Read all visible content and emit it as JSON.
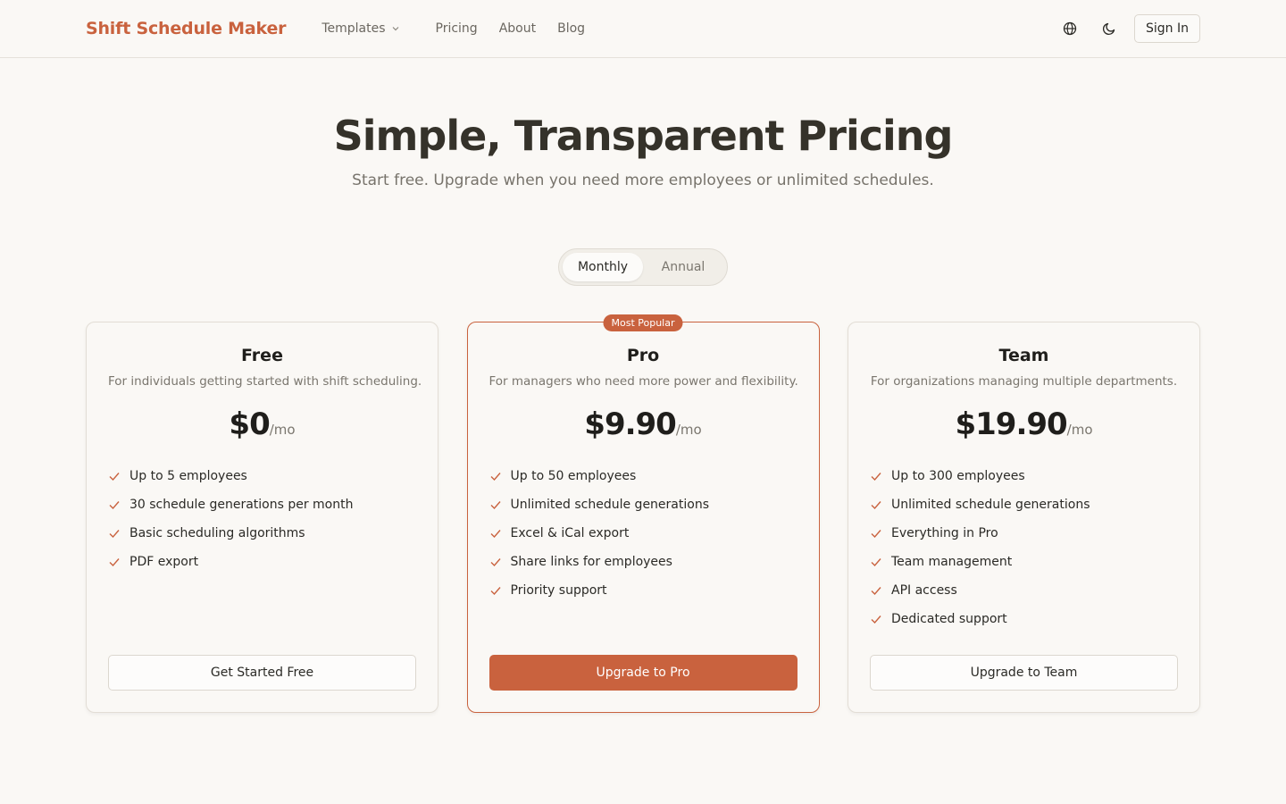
{
  "brand": "Shift Schedule Maker",
  "nav": {
    "templates": "Templates",
    "pricing": "Pricing",
    "about": "About",
    "blog": "Blog"
  },
  "header": {
    "sign_in": "Sign In"
  },
  "hero": {
    "title": "Simple, Transparent Pricing",
    "subtitle": "Start free. Upgrade when you need more employees or unlimited schedules."
  },
  "billing_toggle": {
    "monthly": "Monthly",
    "annual": "Annual",
    "selected": "Monthly"
  },
  "colors": {
    "accent": "#c9623e",
    "background": "#faf8f5"
  },
  "plans": [
    {
      "name": "Free",
      "description": "For individuals getting started with shift scheduling.",
      "price": "$0",
      "unit": "/mo",
      "features": [
        "Up to 5 employees",
        "30 schedule generations per month",
        "Basic scheduling algorithms",
        "PDF export"
      ],
      "button": "Get Started Free"
    },
    {
      "name": "Pro",
      "badge": "Most Popular",
      "description": "For managers who need more power and flexibility.",
      "price": "$9.90",
      "unit": "/mo",
      "features": [
        "Up to 50 employees",
        "Unlimited schedule generations",
        "Excel & iCal export",
        "Share links for employees",
        "Priority support"
      ],
      "button": "Upgrade to Pro"
    },
    {
      "name": "Team",
      "description": "For organizations managing multiple departments.",
      "price": "$19.90",
      "unit": "/mo",
      "features": [
        "Up to 300 employees",
        "Unlimited schedule generations",
        "Everything in Pro",
        "Team management",
        "API access",
        "Dedicated support"
      ],
      "button": "Upgrade to Team"
    }
  ]
}
